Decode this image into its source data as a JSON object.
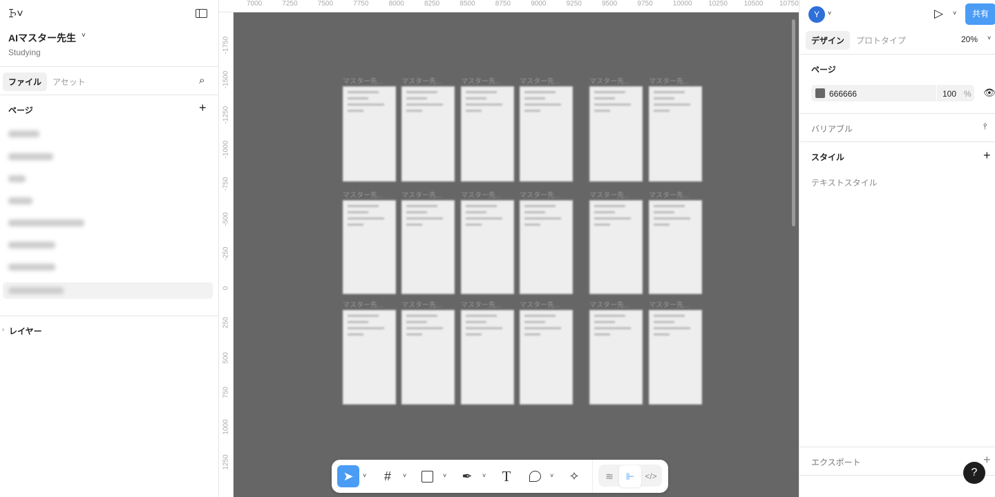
{
  "left": {
    "project_title": "AIマスター先生",
    "project_team": "Studying",
    "tabs": [
      "ファイル",
      "アセット"
    ],
    "pages_heading": "ページ",
    "layers_heading": "レイヤー"
  },
  "rulers": {
    "top": [
      "7000",
      "7250",
      "7500",
      "7750",
      "8000",
      "8250",
      "8500",
      "8750",
      "9000",
      "9250",
      "9500",
      "9750",
      "10000",
      "10250",
      "10500",
      "10750"
    ],
    "left": [
      "-1750",
      "-1500",
      "-1250",
      "-1000",
      "-750",
      "-500",
      "-250",
      "0",
      "250",
      "500",
      "750",
      "1000",
      "1250"
    ]
  },
  "canvas": {
    "frame_title": "マスター先..."
  },
  "right": {
    "avatar_initial": "Y",
    "share_label": "共有",
    "tabs": [
      "デザイン",
      "プロトタイプ"
    ],
    "zoom": "20%",
    "page_heading": "ページ",
    "bg_color": "666666",
    "bg_opacity": "100",
    "percent": "%",
    "variables": "バリアブル",
    "styles": "スタイル",
    "text_styles": "テキストスタイル",
    "export": "エクスポート",
    "help": "?"
  },
  "colors": {
    "accent": "#4a9cf5",
    "canvas": "#666666"
  }
}
